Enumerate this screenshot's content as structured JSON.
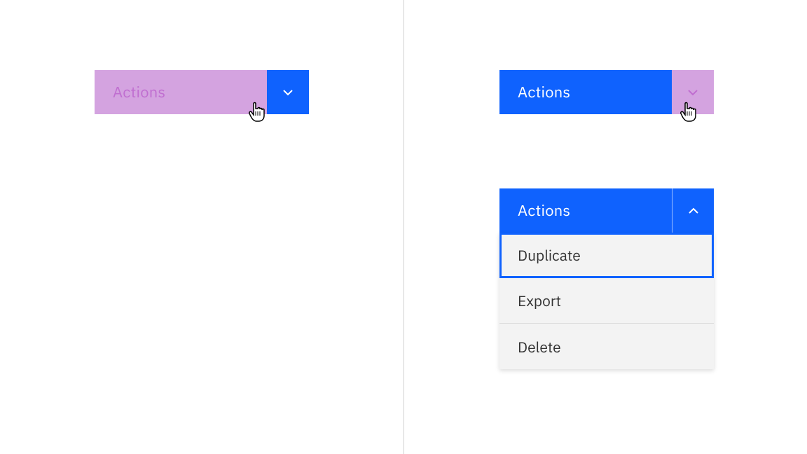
{
  "colors": {
    "primary": "#0f62fe",
    "overlay": "#d4a3e0",
    "menu_bg": "#f3f3f3",
    "text_menu": "#323232"
  },
  "left_panel": {
    "split_button": {
      "label": "Actions",
      "highlighted_segment": "main"
    }
  },
  "right_panel": {
    "closed": {
      "label": "Actions",
      "highlighted_segment": "trigger"
    },
    "open": {
      "label": "Actions",
      "menu_items": [
        {
          "label": "Duplicate",
          "focused": true
        },
        {
          "label": "Export",
          "focused": false
        },
        {
          "label": "Delete",
          "focused": false
        }
      ]
    }
  }
}
